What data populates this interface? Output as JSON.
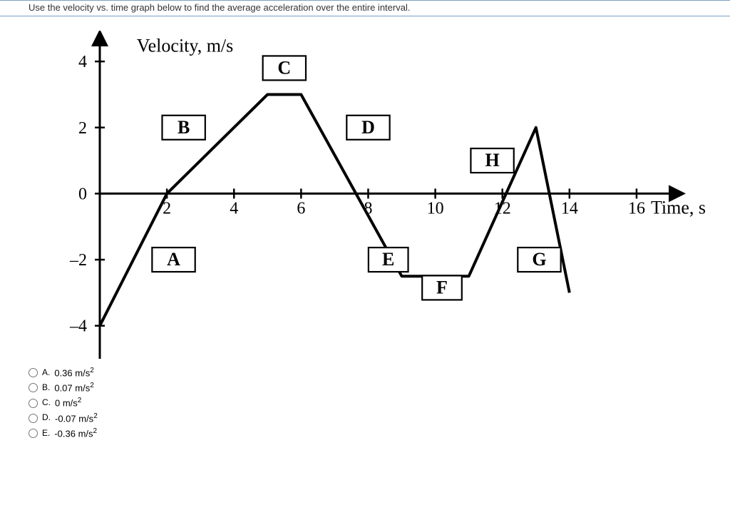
{
  "question": "Use the velocity vs. time graph below to find the average acceleration over the entire interval.",
  "chart_data": {
    "type": "line",
    "title": "",
    "ylabel": "Velocity, m/s",
    "xlabel": "Time, s",
    "xlim": [
      0,
      17
    ],
    "ylim": [
      -5,
      4.5
    ],
    "x_ticks": [
      2,
      4,
      6,
      8,
      10,
      12,
      14,
      16
    ],
    "y_ticks": [
      -4,
      -2,
      0,
      2,
      4
    ],
    "grid": false,
    "series": [
      {
        "name": "velocity",
        "x": [
          0,
          2,
          5,
          6,
          9,
          11,
          13,
          14
        ],
        "y": [
          -4,
          0,
          3,
          3,
          -2.5,
          -2.5,
          2,
          -3
        ]
      }
    ],
    "segment_labels": [
      {
        "name": "A",
        "box_x": 2.2,
        "box_y": -2,
        "w": 0.9,
        "h": 1.1
      },
      {
        "name": "B",
        "box_x": 2.5,
        "box_y": 2,
        "w": 0.9,
        "h": 1.1
      },
      {
        "name": "C",
        "box_x": 5.5,
        "box_y": 3.8,
        "w": 0.9,
        "h": 1.1
      },
      {
        "name": "D",
        "box_x": 8.0,
        "box_y": 2,
        "w": 0.9,
        "h": 1.1
      },
      {
        "name": "E",
        "box_x": 8.6,
        "box_y": -2,
        "w": 0.8,
        "h": 1.1
      },
      {
        "name": "F",
        "box_x": 10.2,
        "box_y": -2.85,
        "w": 0.8,
        "h": 1.1
      },
      {
        "name": "G",
        "box_x": 13.1,
        "box_y": -2,
        "w": 0.9,
        "h": 1.1
      },
      {
        "name": "H",
        "box_x": 11.7,
        "box_y": 1,
        "w": 0.9,
        "h": 1.1
      }
    ]
  },
  "options": [
    {
      "letter": "A.",
      "text": "0.36 m/s",
      "exp": "2"
    },
    {
      "letter": "B.",
      "text": "0.07 m/s",
      "exp": "2"
    },
    {
      "letter": "C.",
      "text": "0 m/s",
      "exp": "2"
    },
    {
      "letter": "D.",
      "text": "-0.07 m/s",
      "exp": "2"
    },
    {
      "letter": "E.",
      "text": "-0.36 m/s",
      "exp": "2"
    }
  ]
}
